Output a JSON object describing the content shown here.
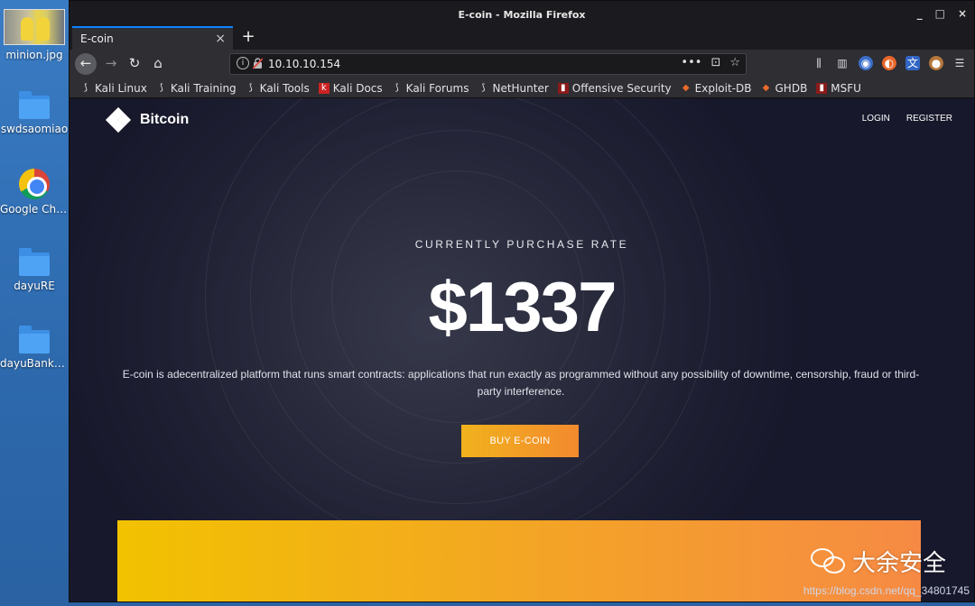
{
  "desktop": {
    "icons": [
      {
        "label": "minion.jpg",
        "type": "image"
      },
      {
        "label": "swdsaomiao",
        "type": "folder"
      },
      {
        "label": "Google Chr...",
        "type": "chrome"
      },
      {
        "label": "dayuRE",
        "type": "folder"
      },
      {
        "label": "dayuBankro...",
        "type": "folder"
      }
    ]
  },
  "window": {
    "title": "E-coin - Mozilla Firefox",
    "controls": {
      "minimize": "_",
      "maximize": "□",
      "close": "×"
    }
  },
  "tabs": [
    {
      "label": "E-coin",
      "active": true
    }
  ],
  "navbar": {
    "url": "10.10.10.154",
    "page_actions": [
      "•••",
      "pocket-icon",
      "star-icon"
    ],
    "toolbar_icons": [
      "library-icon",
      "sidebar-icon",
      "extension-icon",
      "firefox-icon",
      "translate-icon",
      "theme-icon",
      "menu-icon"
    ]
  },
  "bookmarks": [
    {
      "label": "Kali Linux",
      "icon": "kali-dragon-icon"
    },
    {
      "label": "Kali Training",
      "icon": "kali-dragon-icon"
    },
    {
      "label": "Kali Tools",
      "icon": "kali-dragon-icon"
    },
    {
      "label": "Kali Docs",
      "icon": "kali-docs-icon"
    },
    {
      "label": "Kali Forums",
      "icon": "kali-dragon-icon"
    },
    {
      "label": "NetHunter",
      "icon": "nethunter-icon"
    },
    {
      "label": "Offensive Security",
      "icon": "offsec-icon"
    },
    {
      "label": "Exploit-DB",
      "icon": "exploitdb-icon"
    },
    {
      "label": "GHDB",
      "icon": "ghdb-icon"
    },
    {
      "label": "MSFU",
      "icon": "msfu-icon"
    }
  ],
  "site": {
    "brand": "Bitcoin",
    "menu": [
      "LOGIN",
      "REGISTER"
    ],
    "hero_kicker": "CURRENTLY PURCHASE RATE",
    "hero_price": "$1337",
    "hero_desc": "E-coin is adecentralized platform that runs smart contracts: applications that run exactly as programmed without any possibility of downtime, censorship, fraud or third-party interference.",
    "buy_label": "BUY E-COIN"
  },
  "watermark": {
    "text": "大余安全",
    "url": "https://blog.csdn.net/qq_34801745"
  },
  "colors": {
    "accent": "#0a84ff",
    "button_from": "#f1b21d",
    "button_to": "#f28a2e",
    "banner_from": "#f2c200",
    "banner_to": "#f68a44"
  }
}
